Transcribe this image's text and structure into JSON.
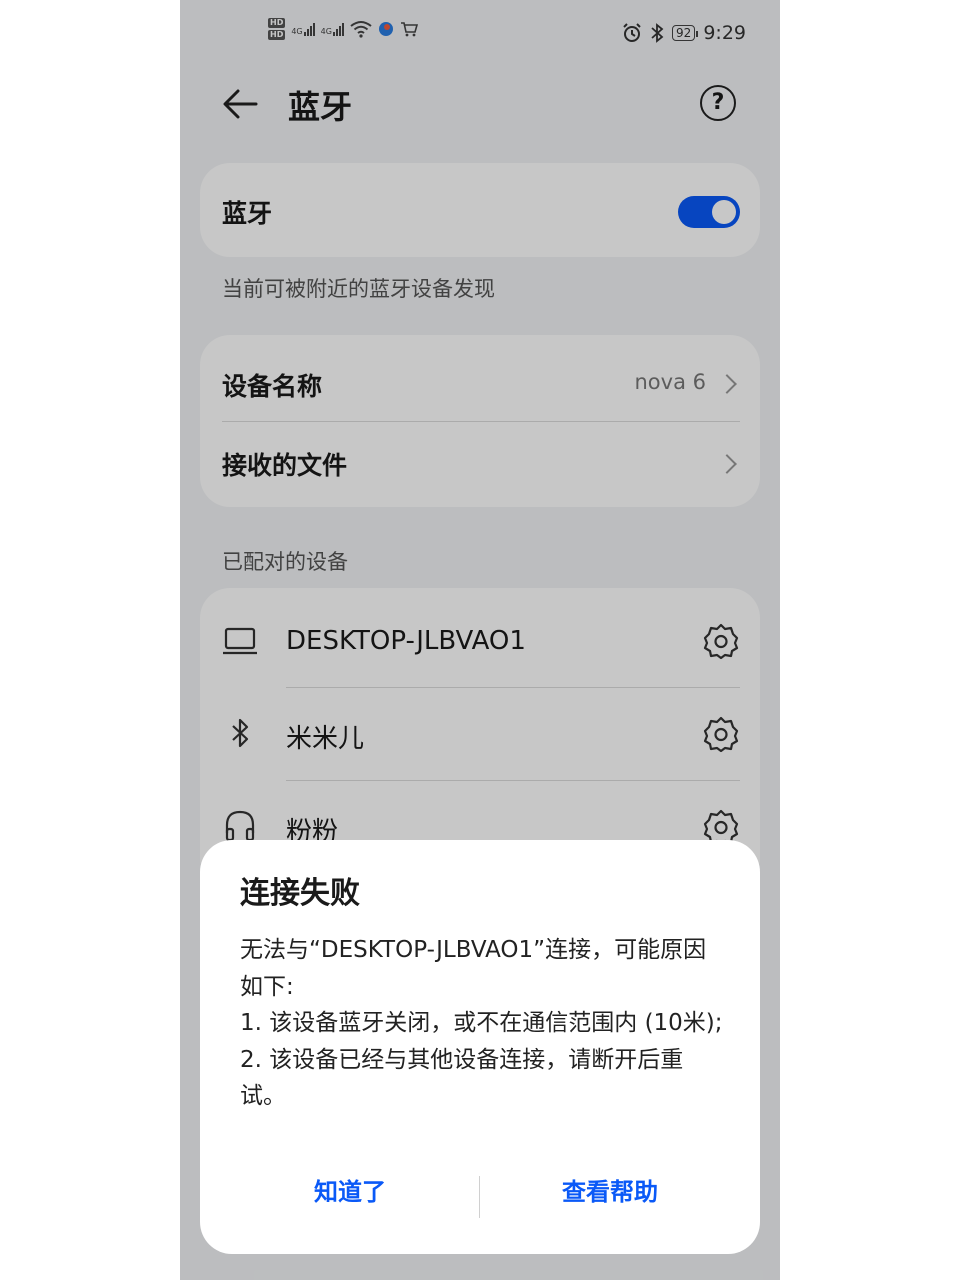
{
  "status_bar": {
    "hd1": "HD",
    "hd2": "HD",
    "sig1": "4G",
    "sig2": "4G",
    "battery": "92",
    "time": "9:29",
    "icons": [
      "wifi-icon",
      "app-icon",
      "cart-icon",
      "alarm-icon",
      "bluetooth-icon"
    ]
  },
  "app_bar": {
    "title": "蓝牙",
    "help": "?"
  },
  "bluetooth_card": {
    "label": "蓝牙",
    "toggle_on": true
  },
  "discoverable_note": "当前可被附近的蓝牙设备发现",
  "settings_card": {
    "device_name_label": "设备名称",
    "device_name_value": "nova 6",
    "received_files_label": "接收的文件"
  },
  "paired_header": "已配对的设备",
  "paired_devices": [
    {
      "name": "DESKTOP-JLBVAO1",
      "icon": "laptop-icon"
    },
    {
      "name": "米米儿",
      "icon": "bluetooth-icon"
    },
    {
      "name": "粉粉",
      "icon": "headphones-icon"
    }
  ],
  "dialog": {
    "title": "连接失败",
    "body": "无法与“DESKTOP-JLBVAO1”连接，可能原因如下:\n1. 该设备蓝牙关闭，或不在通信范围内 (10米);\n2. 该设备已经与其他设备连接，请断开后重试。",
    "ok_button": "知道了",
    "help_button": "查看帮助"
  },
  "colors": {
    "accent": "#0a59f7",
    "background": "#f1f3f5",
    "card": "#ffffff"
  }
}
